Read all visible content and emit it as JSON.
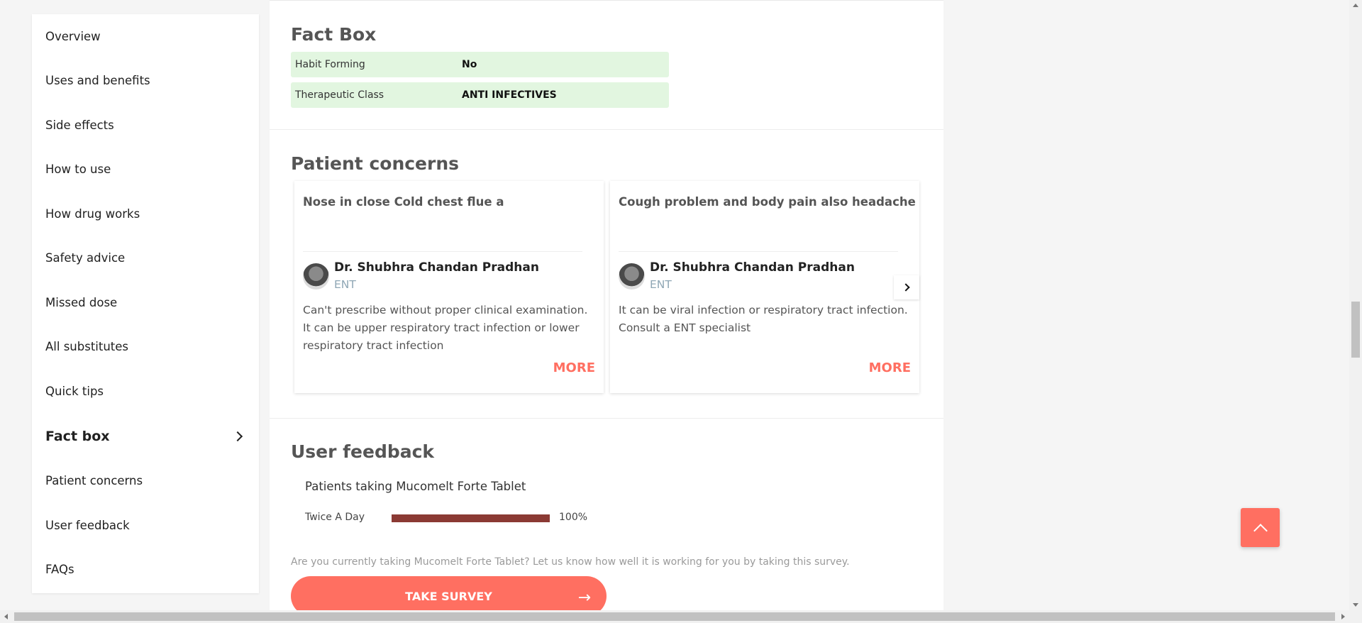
{
  "sidebar": {
    "items": [
      {
        "label": "Overview"
      },
      {
        "label": "Uses and benefits"
      },
      {
        "label": "Side effects"
      },
      {
        "label": "How to use"
      },
      {
        "label": "How drug works"
      },
      {
        "label": "Safety advice"
      },
      {
        "label": "Missed dose"
      },
      {
        "label": "All substitutes"
      },
      {
        "label": "Quick tips"
      },
      {
        "label": "Fact box",
        "active": true
      },
      {
        "label": "Patient concerns"
      },
      {
        "label": "User feedback"
      },
      {
        "label": "FAQs"
      }
    ]
  },
  "fact_box": {
    "title": "Fact Box",
    "rows": [
      {
        "label": "Habit Forming",
        "value": "No"
      },
      {
        "label": "Therapeutic Class",
        "value": "ANTI INFECTIVES"
      }
    ]
  },
  "patient_concerns": {
    "title": "Patient concerns",
    "cards": [
      {
        "question": "Nose in close Cold chest flue a",
        "doctor": "Dr. Shubhra Chandan Pradhan",
        "specialty": "ENT",
        "answer": "Can't prescribe without proper clinical examination. It can be upper respiratory tract infection or lower respiratory tract infection",
        "more": "MORE"
      },
      {
        "question": "Cough problem and body pain also headache",
        "doctor": "Dr. Shubhra Chandan Pradhan",
        "specialty": "ENT",
        "answer": "It can be viral infection or respiratory tract infection. Consult a ENT specialist",
        "more": "MORE"
      }
    ]
  },
  "user_feedback": {
    "title": "User feedback",
    "subtitle": "Patients taking Mucomelt Forte Tablet",
    "rows": [
      {
        "label": "Twice A Day",
        "percent_text": "100%",
        "percent": 100
      }
    ],
    "survey_prompt": "Are you currently taking Mucomelt Forte Tablet? Let us know how well it is working for you by taking this survey.",
    "survey_button": "TAKE SURVEY"
  },
  "colors": {
    "accent": "#ff6f61",
    "fact_row_bg": "#e2f6e0",
    "feedback_bar": "#8b3a34"
  }
}
